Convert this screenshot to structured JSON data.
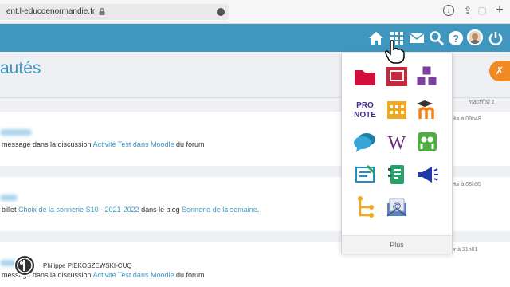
{
  "browser": {
    "url": "ent.l-educdenormandie.fr"
  },
  "header": {
    "icons": [
      "home-icon",
      "apps-grid-icon",
      "mail-icon",
      "search-icon",
      "help-icon",
      "avatar",
      "power-icon"
    ]
  },
  "page": {
    "title": "autés",
    "inactive_label": "Inactif(s) 1",
    "tools_icon": "tools-icon"
  },
  "feed": [
    {
      "prefix": "message dans la discussion ",
      "link": "Activité Test dans Moodle",
      "suffix": "  du forum",
      "time": "Hui à 09h48"
    },
    {
      "prefix": "billet ",
      "link": "Choix de la sonnerie S10 - 2021-2022",
      "middle": " dans le blog ",
      "link2": "Sonnerie de la semaine",
      "suffix": ".",
      "time": "Hui à 08h55"
    },
    {
      "author": "Philippe PIEKOSZEWSKI-CUQ",
      "prefix": "message dans la discussion ",
      "link": "Activité Test dans Moodle",
      "suffix": "  du forum",
      "time": "er à 21h01"
    }
  ],
  "apps_menu": {
    "apps": [
      "folder-icon",
      "presentation-icon",
      "cubes-icon",
      "pronote-icon",
      "calendar-icon",
      "moodle-icon",
      "chat-icon",
      "wikipedia-icon",
      "slideshare-icon",
      "exercise-icon",
      "notebook-icon",
      "megaphone-icon",
      "tree-icon",
      "email-app-icon"
    ],
    "pronote_label": "PRO NOTE",
    "wiki_letter": "W",
    "more_label": "Plus"
  }
}
